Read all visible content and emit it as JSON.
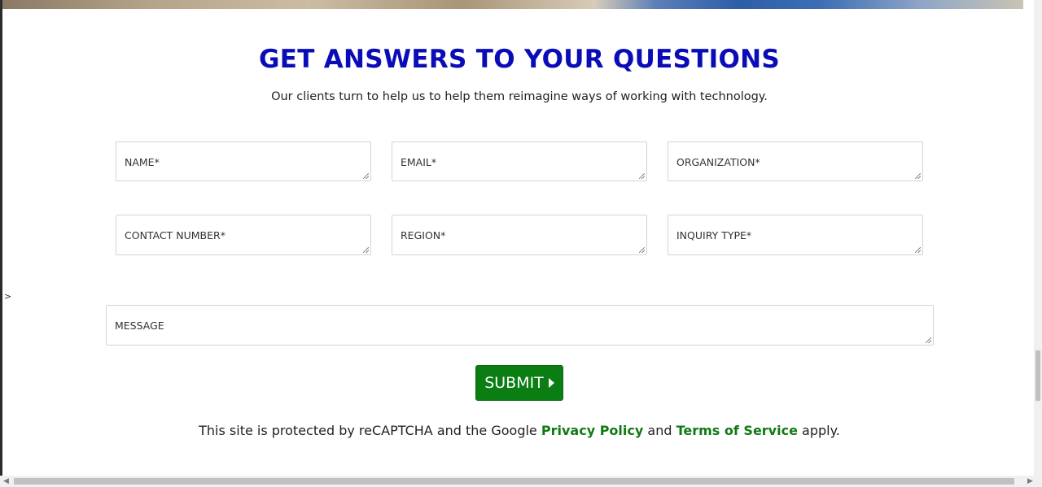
{
  "header": {
    "title": "GET ANSWERS TO YOUR QUESTIONS",
    "subtitle": "Our clients turn to help us to help them reimagine ways of working with technology."
  },
  "form": {
    "fields": [
      {
        "placeholder": "NAME*"
      },
      {
        "placeholder": "EMAIL*"
      },
      {
        "placeholder": "ORGANIZATION*"
      },
      {
        "placeholder": "CONTACT NUMBER*"
      },
      {
        "placeholder": "REGION*"
      },
      {
        "placeholder": "INQUIRY TYPE*"
      }
    ],
    "message_placeholder": "MESSAGE",
    "submit_label": "SUBMIT"
  },
  "notice": {
    "prefix": "This site is protected by reCAPTCHA and the Google",
    "privacy_link": "Privacy Policy",
    "middle": "and",
    "terms_link": "Terms of Service",
    "suffix": "apply."
  },
  "misc": {
    "collapse_arrow": ">"
  },
  "colors": {
    "heading": "#0a0cb8",
    "submit_bg": "#0a7d13",
    "link": "#0f7a14"
  }
}
